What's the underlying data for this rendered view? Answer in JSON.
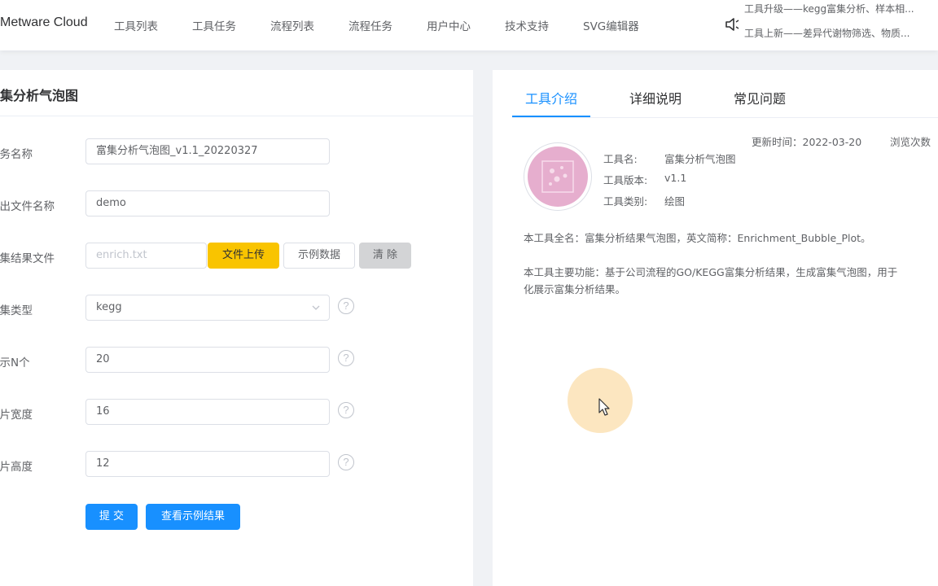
{
  "header": {
    "brand": "Metware Cloud",
    "nav": [
      "工具列表",
      "工具任务",
      "流程列表",
      "流程任务",
      "用户中心",
      "技术支持",
      "SVG编辑器"
    ],
    "notice_lines": [
      "工具升级——kegg富集分析、样本相...",
      "工具上新——差异代谢物筛选、物质..."
    ]
  },
  "form": {
    "title": "富集分析气泡图",
    "task_name": {
      "label": "任务名称",
      "value": "富集分析气泡图_v1.1_20220327"
    },
    "output_name": {
      "label": "输出文件名称",
      "value": "demo"
    },
    "result_file": {
      "label": "富集结果文件",
      "placeholder": "enrich.txt",
      "upload_label": "文件上传",
      "example_label": "示例数据",
      "clear_label": "清 除"
    },
    "enrich_type": {
      "label": "富集类型",
      "value": "kegg"
    },
    "show_n": {
      "label": "展示N个",
      "value": "20"
    },
    "width": {
      "label": "图片宽度",
      "value": "16"
    },
    "height": {
      "label": "图片高度",
      "value": "12"
    },
    "submit_label": "提 交",
    "view_example_label": "查看示例结果",
    "help_glyph": "?"
  },
  "info": {
    "tabs": [
      "工具介绍",
      "详细说明",
      "常见问题"
    ],
    "active_tab": 0,
    "update_time": "更新时间：2022-03-20",
    "view_count": "浏览次数",
    "tool_name_label": "工具名:",
    "tool_name": "富集分析气泡图",
    "version_label": "工具版本:",
    "version": "v1.1",
    "category_label": "工具类别:",
    "category": "绘图",
    "full_name_desc": "本工具全名：富集分析结果气泡图，英文简称：Enrichment_Bubble_Plot。",
    "function_desc_line1": "本工具主要功能：基于公司流程的GO/KEGG富集分析结果，生成富集气泡图，用于",
    "function_desc_line2": "化展示富集分析结果。"
  },
  "colors": {
    "primary": "#1890ff",
    "upload": "#f9c400",
    "clear": "#d3d4d6",
    "tool_image": "#e6aece"
  }
}
